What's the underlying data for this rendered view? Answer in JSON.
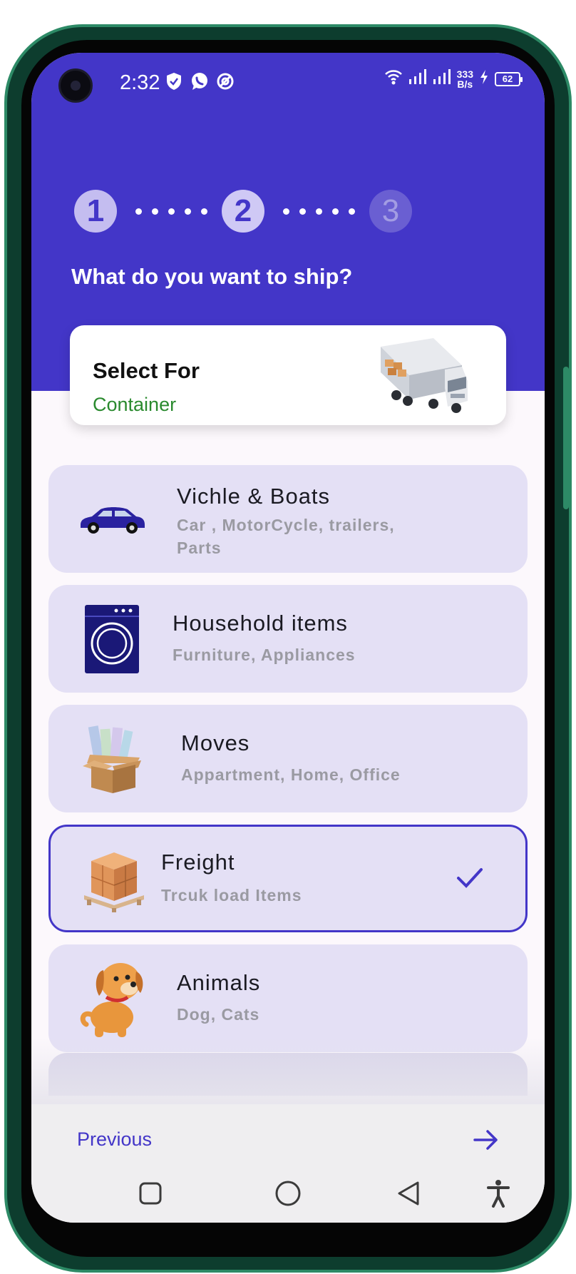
{
  "status_bar": {
    "time": "2:32",
    "left_icons": [
      "shield-check-icon",
      "whatsapp-icon",
      "vpn-icon"
    ],
    "right_icons": [
      "wifi-icon",
      "signal-icon",
      "signal-icon",
      "charging-icon"
    ],
    "net_speed_value": "333",
    "net_speed_unit": "B/s",
    "battery_level": "62"
  },
  "stepper": {
    "steps": [
      {
        "label": "1",
        "state": "done"
      },
      {
        "label": "2",
        "state": "current"
      },
      {
        "label": "3",
        "state": "pending"
      }
    ]
  },
  "header": {
    "question": "What do you want to ship?"
  },
  "select_card": {
    "title": "Select For",
    "value": "Container",
    "icon": "container-truck-icon"
  },
  "categories": [
    {
      "name": "Vichle & Boats",
      "desc": "Car , MotorCycle, trailers, Parts",
      "icon": "car-icon",
      "selected": false
    },
    {
      "name": "Household items",
      "desc": "Furniture, Appliances",
      "icon": "washing-machine-icon",
      "selected": false
    },
    {
      "name": "Moves",
      "desc": "Appartment, Home, Office",
      "icon": "moving-box-icon",
      "selected": false
    },
    {
      "name": "Freight",
      "desc": "Trcuk load Items",
      "icon": "pallet-boxes-icon",
      "selected": true
    },
    {
      "name": "Animals",
      "desc": "Dog, Cats",
      "icon": "dog-icon",
      "selected": false
    }
  ],
  "footer": {
    "previous_label": "Previous",
    "next_icon": "arrow-right-icon"
  },
  "colors": {
    "primary": "#4336c8",
    "card_bg": "#e4e0f5",
    "accent_green": "#2a8a2e",
    "muted_text": "#9a9aa2"
  }
}
